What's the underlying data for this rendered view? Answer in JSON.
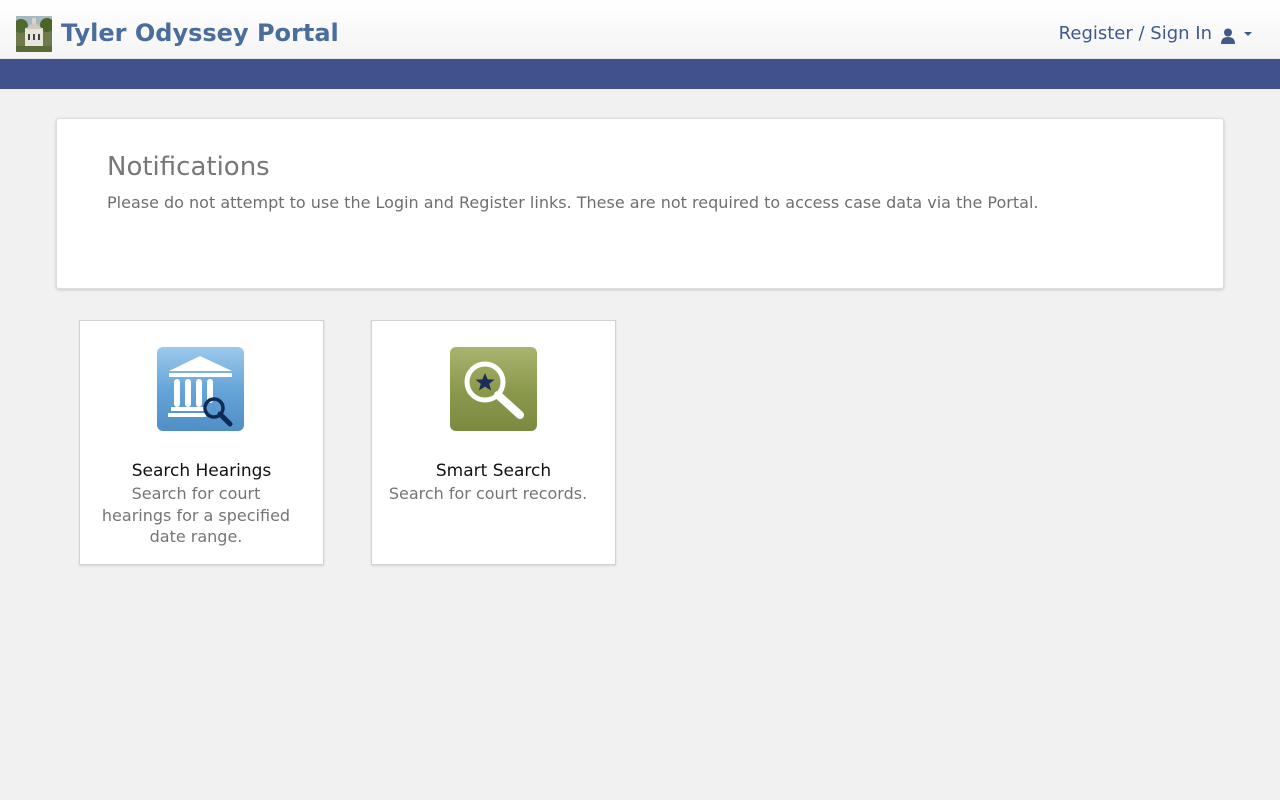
{
  "header": {
    "brand_title": "Tyler Odyssey Portal",
    "signin_label": "Register / Sign In"
  },
  "notifications": {
    "title": "Notifications",
    "message": "Please do not attempt to use the Login and Register links. These are not required to access case data via the Portal."
  },
  "tiles": [
    {
      "title": "Search Hearings",
      "description": "Search for court hearings for a specified date range.",
      "icon": "courthouse-search-icon"
    },
    {
      "title": "Smart Search",
      "description": "Search for court records.",
      "icon": "magnifier-star-icon"
    }
  ],
  "colors": {
    "brand": "#4a6d9c",
    "navbar": "#40518d",
    "hearings_icon_bg": "#5b9bd0",
    "smart_search_icon_bg": "#8a9a4e"
  }
}
